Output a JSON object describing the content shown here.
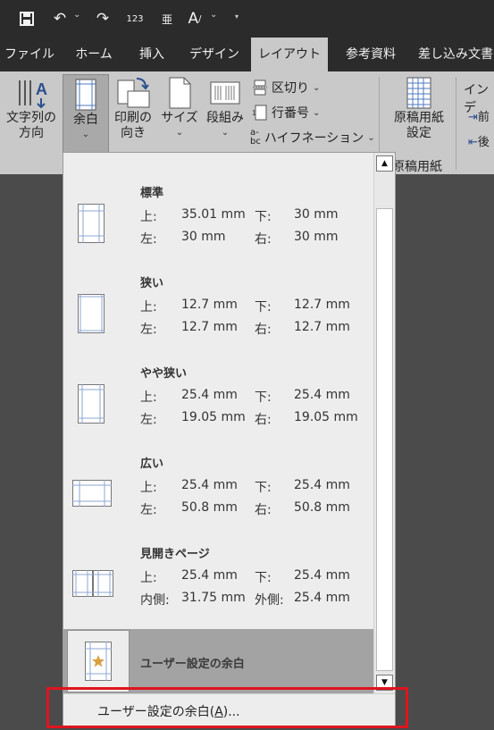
{
  "qat": {
    "icons": [
      "save-icon",
      "undo-icon",
      "redo-icon",
      "numbering-icon",
      "ruby-icon",
      "text-effects-icon",
      "customize-qat-icon"
    ],
    "numbering_glyph": "123"
  },
  "tabs": [
    "ファイル",
    "ホーム",
    "挿入",
    "デザイン",
    "レイアウト",
    "参考資料",
    "差し込み文書"
  ],
  "active_tab": "レイアウト",
  "ribbon": {
    "text_direction": [
      "文字列の",
      "方向"
    ],
    "margins": "余白",
    "orientation": [
      "印刷の",
      "向き"
    ],
    "size": "サイズ",
    "columns": "段組み",
    "breaks": "区切り",
    "line_numbers": "行番号",
    "hyphenation": "ハイフネーション",
    "genko": [
      "原稿用紙",
      "設定"
    ],
    "genko_group": "原稿用紙",
    "indent_group": "インデ",
    "indent_left_glyph": "前",
    "indent_right_glyph": "後",
    "hyphen_glyph": [
      "a-",
      "bc"
    ]
  },
  "margins_menu": {
    "items": [
      {
        "title": "標準",
        "row1": [
          "上:",
          "35.01 mm",
          "下:",
          "30 mm"
        ],
        "row2": [
          "左:",
          "30 mm",
          "右:",
          "30 mm"
        ]
      },
      {
        "title": "狭い",
        "row1": [
          "上:",
          "12.7 mm",
          "下:",
          "12.7 mm"
        ],
        "row2": [
          "左:",
          "12.7 mm",
          "右:",
          "12.7 mm"
        ]
      },
      {
        "title": "やや狭い",
        "row1": [
          "上:",
          "25.4 mm",
          "下:",
          "25.4 mm"
        ],
        "row2": [
          "左:",
          "19.05 mm",
          "右:",
          "19.05 mm"
        ]
      },
      {
        "title": "広い",
        "row1": [
          "上:",
          "25.4 mm",
          "下:",
          "25.4 mm"
        ],
        "row2": [
          "左:",
          "50.8 mm",
          "右:",
          "50.8 mm"
        ]
      },
      {
        "title": "見開きページ",
        "row1": [
          "上:",
          "25.4 mm",
          "下:",
          "25.4 mm"
        ],
        "row2": [
          "内側:",
          "31.75 mm",
          "外側:",
          "25.4 mm"
        ]
      }
    ],
    "custom_item": "ユーザー設定の余白",
    "footer_prefix": "ユーザー設定の余白(",
    "footer_key": "A",
    "footer_suffix": ")..."
  },
  "colors": {
    "titlebar": "#2b2b2b",
    "ribbon": "#c9c9c9",
    "menu_bg": "#ededed",
    "highlight": "#a3a3a3",
    "annotation": "#e0141e"
  }
}
